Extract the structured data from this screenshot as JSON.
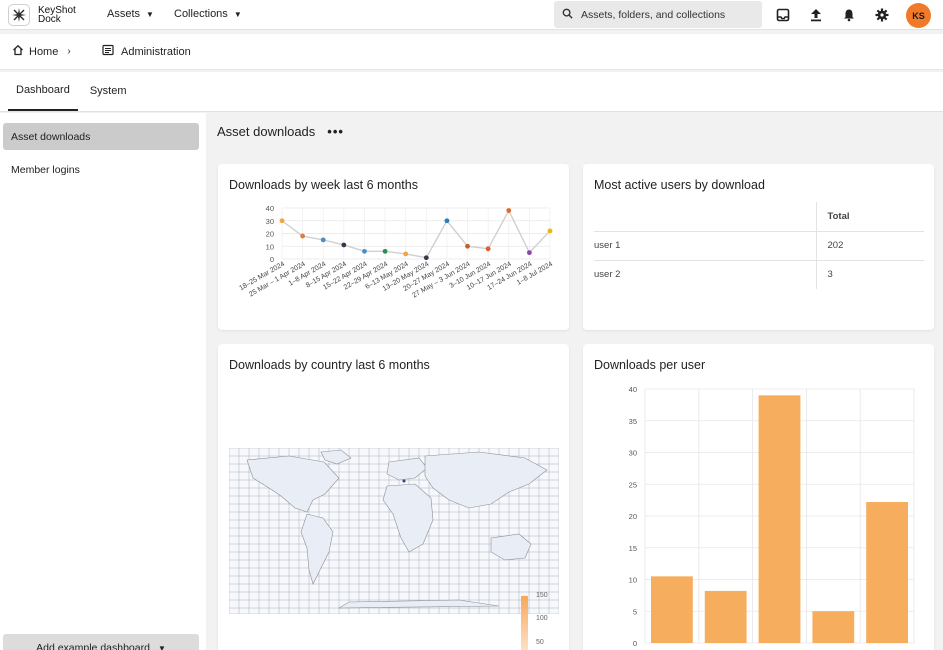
{
  "header": {
    "logo_line1": "KeyShot",
    "logo_line2": "Dock",
    "menus": [
      {
        "label": "Assets"
      },
      {
        "label": "Collections"
      }
    ],
    "search_placeholder": "Assets, folders, and collections",
    "avatar_initials": "KS",
    "avatar_color": "#f07a2a"
  },
  "breadcrumb": {
    "home": "Home",
    "current": "Administration"
  },
  "tabs": [
    {
      "label": "Dashboard",
      "active": true
    },
    {
      "label": "System",
      "active": false
    }
  ],
  "sidebar": {
    "items": [
      {
        "label": "Asset downloads",
        "active": true
      },
      {
        "label": "Member logins",
        "active": false
      }
    ],
    "add_button": "Add example dashboard"
  },
  "main": {
    "title": "Asset downloads",
    "more": "•••"
  },
  "cards": {
    "weekly": {
      "title": "Downloads by week last 6 months"
    },
    "users": {
      "title": "Most active users by download",
      "header": [
        "",
        "Total"
      ],
      "rows": [
        {
          "user": "user 1",
          "total": "202"
        },
        {
          "user": "user 2",
          "total": "3"
        }
      ]
    },
    "country": {
      "title": "Downloads by country last 6 months",
      "legend_ticks": [
        "150",
        "100",
        "50"
      ]
    },
    "per_user": {
      "title": "Downloads per user"
    }
  },
  "chart_data": [
    {
      "type": "line",
      "title": "Downloads by week last 6 months",
      "categories": [
        "18–25 Mar 2024",
        "25 Mar – 1 Apr 2024",
        "1–8 Apr 2024",
        "8–15 Apr 2024",
        "15–22 Apr 2024",
        "22–29 Apr 2024",
        "6–13 May 2024",
        "13–20 May 2024",
        "20–27 May 2024",
        "27 May – 3 Jun 2024",
        "3–10 Jun 2024",
        "10–17 Jun 2024",
        "17–24 Jun 2024",
        "1–8 Jul 2024"
      ],
      "values": [
        30,
        18,
        15,
        11,
        6,
        6,
        4,
        1,
        30,
        10,
        8,
        38,
        5,
        22
      ],
      "point_colors": [
        "#f4a340",
        "#e07b39",
        "#4a90c8",
        "#333a4a",
        "#4a90c8",
        "#2e8b57",
        "#f4a340",
        "#333a4a",
        "#2e7fb8",
        "#c0622b",
        "#e05a2a",
        "#e06a2a",
        "#8e44ad",
        "#f4b400"
      ],
      "y_ticks": [
        0,
        10,
        20,
        30,
        40
      ],
      "ylim": [
        0,
        40
      ],
      "grid": true
    },
    {
      "type": "bar",
      "title": "Downloads per user",
      "values": [
        10.5,
        8.2,
        39,
        5,
        22.2
      ],
      "y_ticks": [
        0,
        5,
        10,
        15,
        20,
        25,
        30,
        35,
        40
      ],
      "ylim": [
        0,
        40
      ],
      "color": "#f7ad5e",
      "grid": true
    }
  ]
}
